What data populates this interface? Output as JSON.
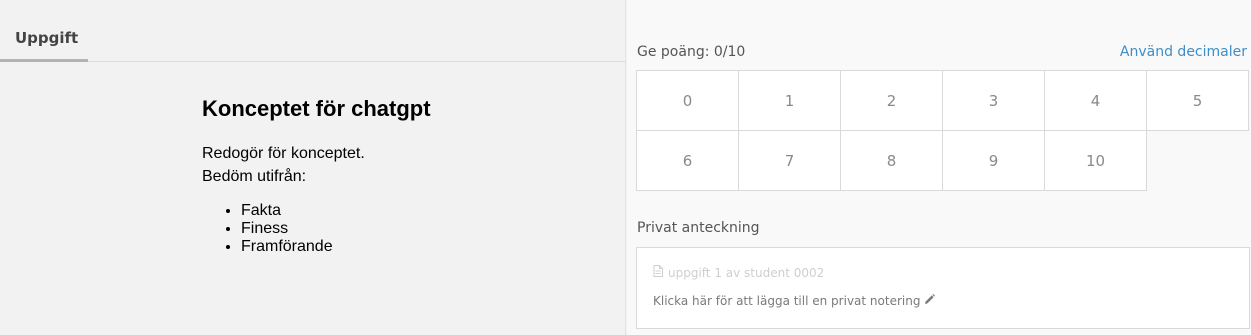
{
  "tabs": [
    {
      "label": "Uppgift",
      "active": true
    }
  ],
  "task": {
    "title": "Konceptet för chatgpt",
    "lines": [
      "Redogör för konceptet.",
      "Bedöm utifrån:"
    ],
    "criteria": [
      "Fakta",
      "Finess",
      "Framförande"
    ]
  },
  "grading": {
    "points_label": "Ge poäng: 0/10",
    "decimals_link": "Använd decimaler",
    "options": [
      "0",
      "1",
      "2",
      "3",
      "4",
      "5",
      "6",
      "7",
      "8",
      "9",
      "10"
    ]
  },
  "note": {
    "label": "Privat anteckning",
    "reference": "uppgift 1 av student 0002",
    "hint": "Klicka här för att lägga till en privat notering",
    "icons": {
      "reference": "document-icon",
      "hint": "pencil-icon"
    }
  },
  "colors": {
    "link": "#3d8ec9",
    "left_bg": "#f2f2f2",
    "right_bg": "#f9f9f9",
    "cell_border": "#d9d9d9"
  }
}
